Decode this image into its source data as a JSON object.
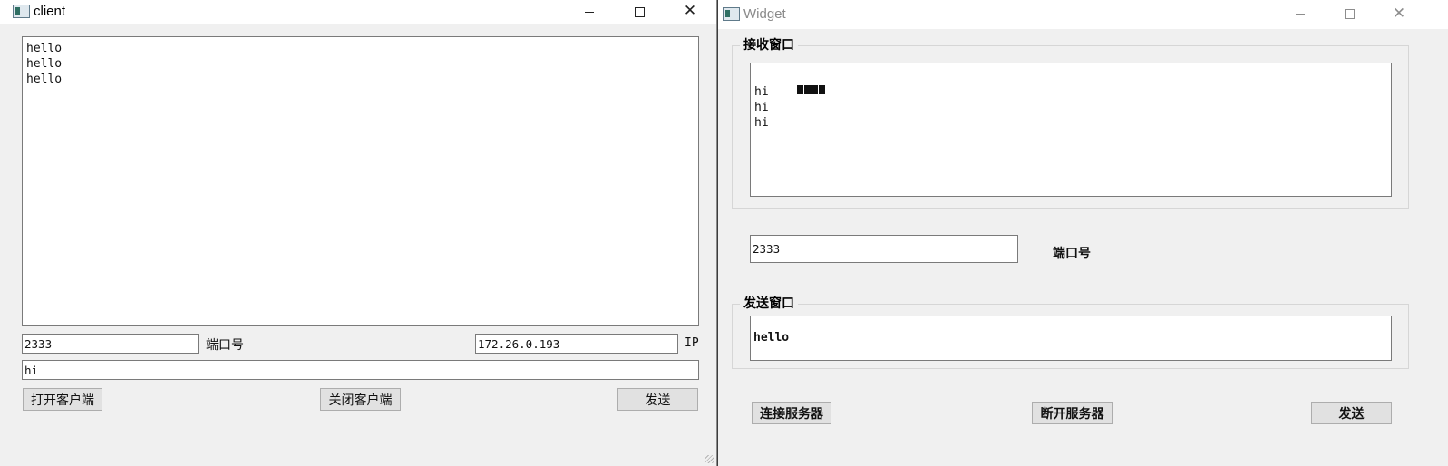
{
  "client": {
    "title": "client",
    "received_lines": [
      "hello",
      "hello",
      "hello"
    ],
    "port_value": "2333",
    "port_label": "端口号",
    "ip_value": "172.26.0.193",
    "ip_label": "IP",
    "message_value": "hi",
    "open_button": "打开客户端",
    "close_button": "关闭客户端",
    "send_button": "发送"
  },
  "widget": {
    "title": "Widget",
    "receive_group_title": "接收窗口",
    "received_lines": [
      "hi",
      "hi",
      "hi"
    ],
    "port_value": "2333",
    "port_label": "端口号",
    "send_group_title": "发送窗口",
    "send_text": "hello",
    "connect_button": "连接服务器",
    "disconnect_button": "断开服务器",
    "send_button": "发送"
  },
  "colors": {
    "window_bg": "#f0f0f0",
    "titlebar_bg": "#ffffff",
    "button_bg": "#e1e1e1"
  }
}
